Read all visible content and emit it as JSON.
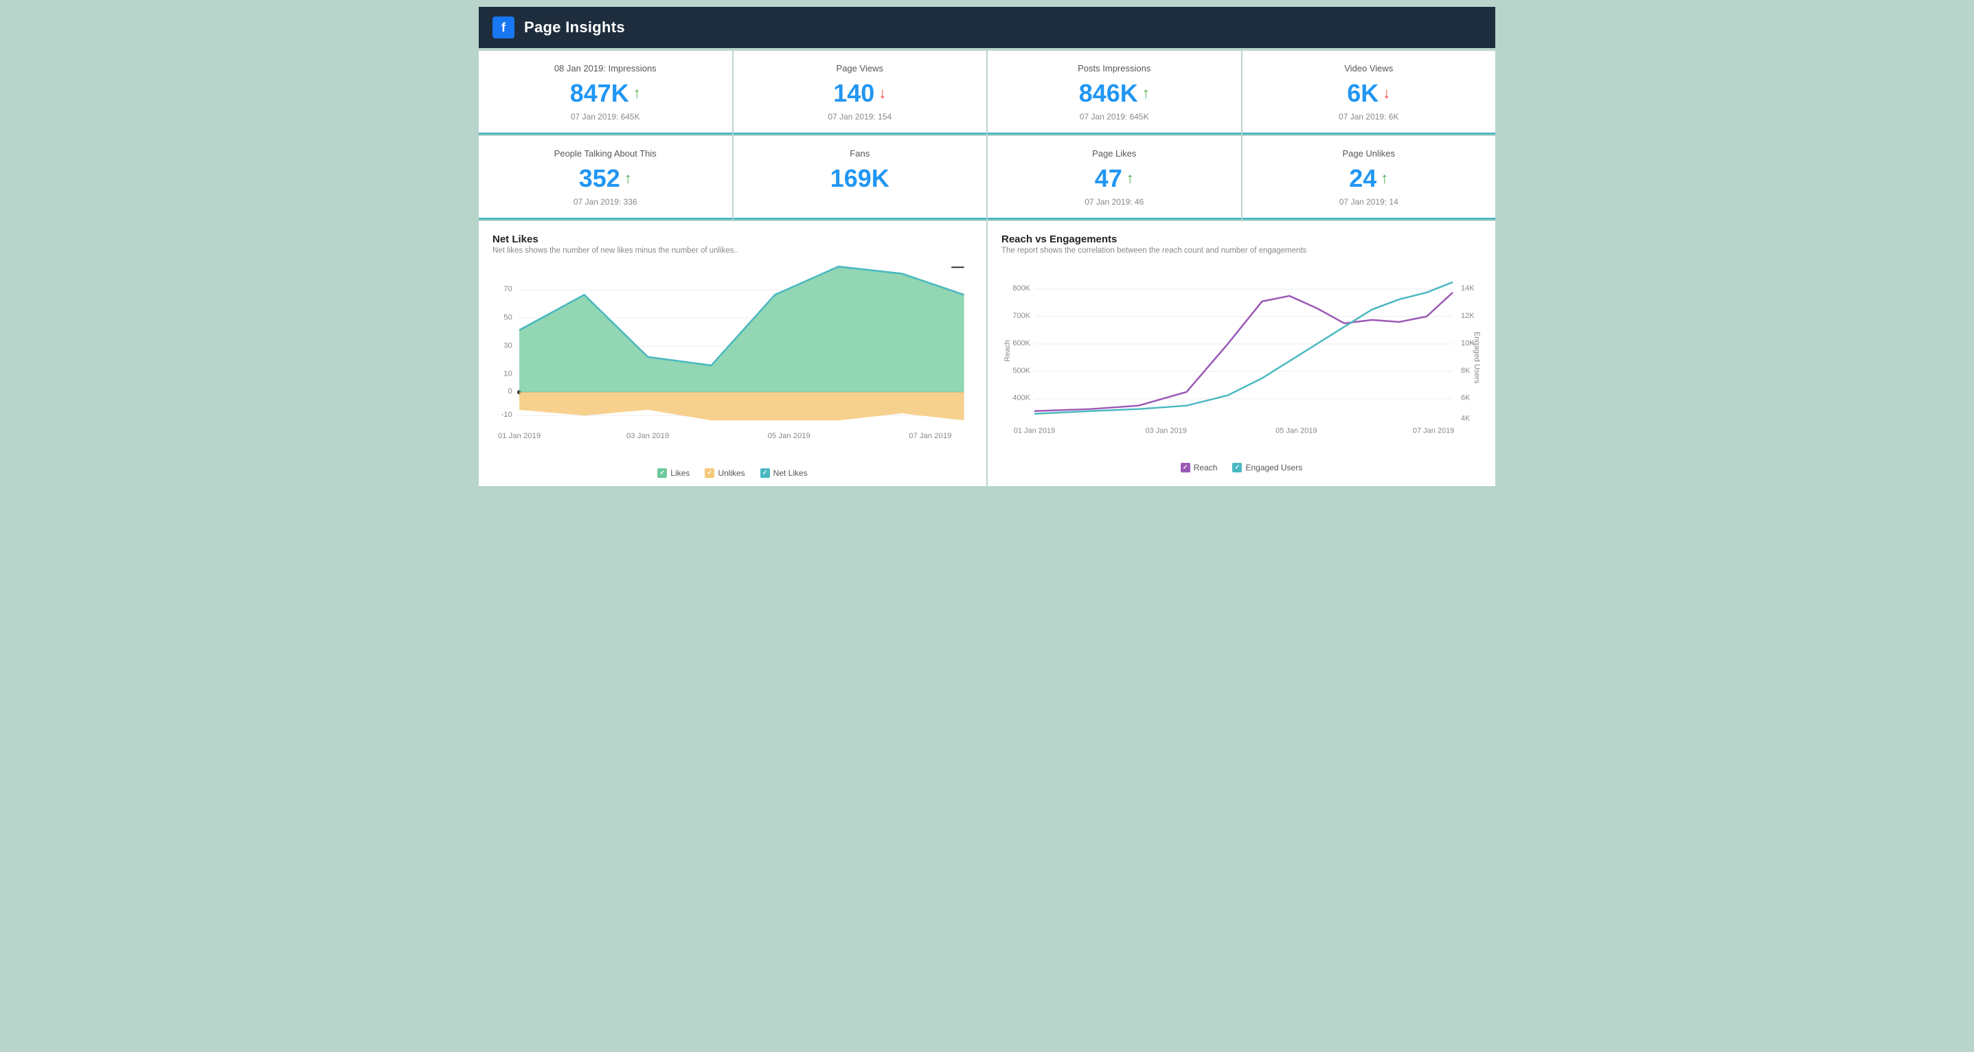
{
  "header": {
    "title": "Page Insights",
    "fb_label": "f"
  },
  "metrics_row1": [
    {
      "label": "08 Jan 2019: Impressions",
      "value": "847K",
      "trend": "up",
      "prev": "07 Jan 2019: 645K"
    },
    {
      "label": "Page Views",
      "value": "140",
      "trend": "down",
      "prev": "07 Jan 2019: 154"
    },
    {
      "label": "Posts Impressions",
      "value": "846K",
      "trend": "up",
      "prev": "07 Jan 2019: 645K"
    },
    {
      "label": "Video Views",
      "value": "6K",
      "trend": "down",
      "prev": "07 Jan 2019: 6K"
    }
  ],
  "metrics_row2": [
    {
      "label": "People Talking About This",
      "value": "352",
      "trend": "up",
      "prev": "07 Jan 2019: 336"
    },
    {
      "label": "Fans",
      "value": "169K",
      "trend": "none",
      "prev": ""
    },
    {
      "label": "Page Likes",
      "value": "47",
      "trend": "up",
      "prev": "07 Jan 2019: 46"
    },
    {
      "label": "Page Unlikes",
      "value": "24",
      "trend": "up",
      "prev": "07 Jan 2019: 14"
    }
  ],
  "net_likes_chart": {
    "title": "Net Likes",
    "subtitle": "Net likes shows the number of new likes minus the number of unlikes..",
    "legend": [
      "Likes",
      "Unlikes",
      "Net Likes"
    ],
    "legend_colors": [
      "#6dc89a",
      "#f5c97a",
      "#4ab8c1"
    ],
    "x_labels": [
      "01 Jan 2019",
      "03 Jan 2019",
      "05 Jan 2019",
      "07 Jan 2019"
    ],
    "y_labels": [
      "70",
      "50",
      "30",
      "10",
      "0",
      "-10"
    ]
  },
  "reach_chart": {
    "title": "Reach vs Engagements",
    "subtitle": "The report shows the correlation between the reach count and number of engagements",
    "legend": [
      "Reach",
      "Engaged Users"
    ],
    "legend_colors": [
      "#9b59b6",
      "#4ab8c1"
    ],
    "x_labels": [
      "01 Jan 2019",
      "03 Jan 2019",
      "05 Jan 2019",
      "07 Jan 2019"
    ],
    "y_labels_left": [
      "800K",
      "700K",
      "600K",
      "500K",
      "400K"
    ],
    "y_labels_right": [
      "14K",
      "12K",
      "10K",
      "8K",
      "6K",
      "4K"
    ],
    "right_axis_label": "Engaged Users",
    "left_axis_label": "Reach"
  }
}
